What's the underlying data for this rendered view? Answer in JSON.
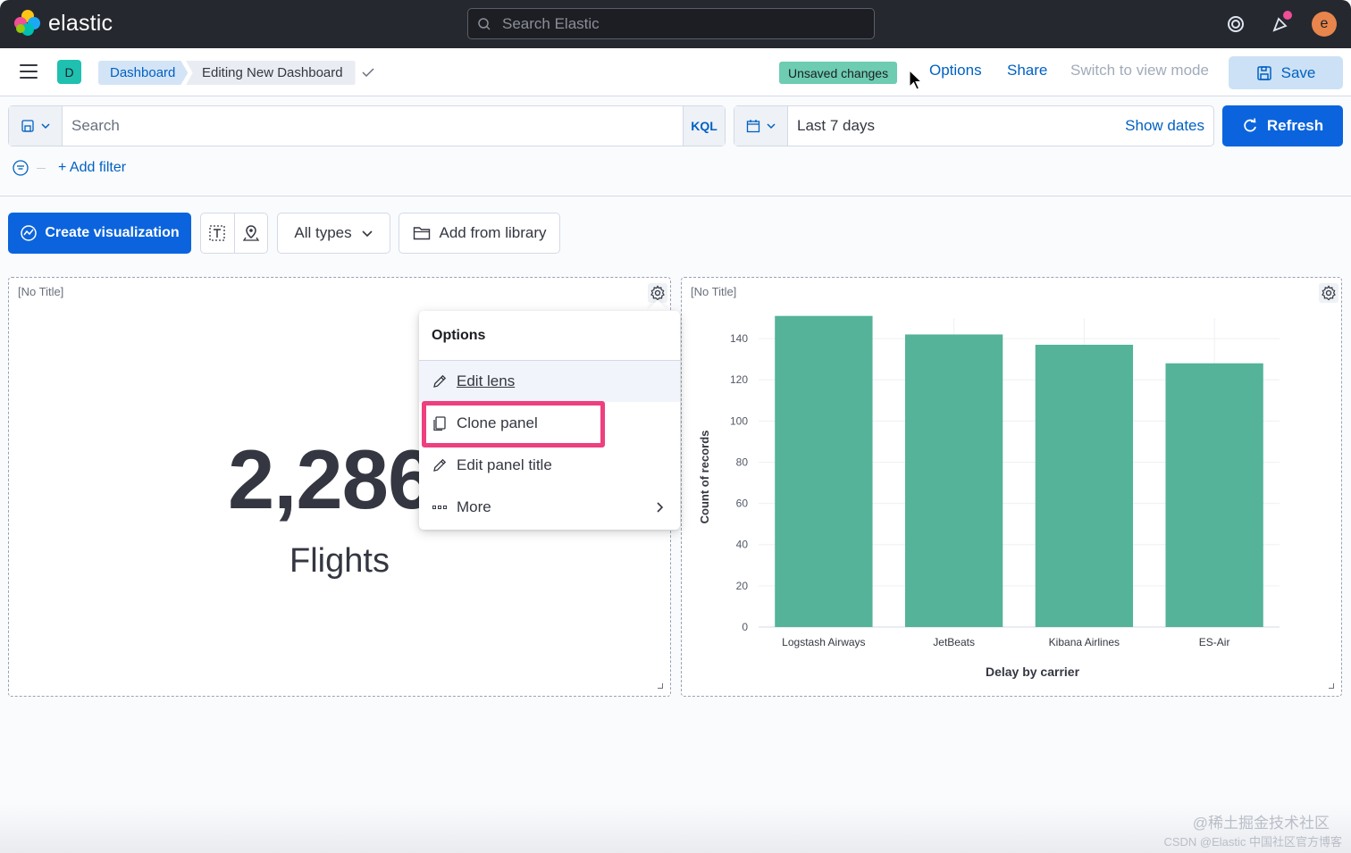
{
  "header": {
    "brand": "elastic",
    "search_placeholder": "Search Elastic",
    "avatar_initial": "e"
  },
  "nav": {
    "space_initial": "D",
    "breadcrumbs": [
      "Dashboard",
      "Editing New Dashboard"
    ],
    "unsaved_badge": "Unsaved changes",
    "options": "Options",
    "share": "Share",
    "switch_view": "Switch to view mode",
    "save": "Save"
  },
  "query": {
    "search_placeholder": "Search",
    "language": "KQL",
    "date_range": "Last 7 days",
    "show_dates": "Show dates",
    "refresh": "Refresh",
    "add_filter": "+ Add filter"
  },
  "toolbar": {
    "create_visualization": "Create visualization",
    "all_types": "All types",
    "add_from_library": "Add from library"
  },
  "panels": {
    "metric": {
      "title": "[No Title]",
      "value": "2,286",
      "label": "Flights"
    },
    "chart": {
      "title": "[No Title]"
    }
  },
  "popover": {
    "title": "Options",
    "items": [
      "Edit lens",
      "Clone panel",
      "Edit panel title",
      "More"
    ]
  },
  "chart_data": {
    "type": "bar",
    "categories": [
      "Logstash Airways",
      "JetBeats",
      "Kibana Airlines",
      "ES-Air"
    ],
    "values": [
      151,
      142,
      137,
      128
    ],
    "xlabel": "Delay by carrier",
    "ylabel": "Count of records",
    "ylim": [
      0,
      150
    ],
    "yticks": [
      0,
      20,
      40,
      60,
      80,
      100,
      120,
      140
    ],
    "color": "#54b399"
  },
  "watermark": {
    "line1": "@稀土掘金技术社区",
    "line2": "CSDN @Elastic 中国社区官方博客"
  },
  "colors": {
    "header_bg": "#25282f",
    "primary": "#0b64dd",
    "link": "#0061c2",
    "bar": "#54b399",
    "highlight": "#ee3f7f"
  }
}
